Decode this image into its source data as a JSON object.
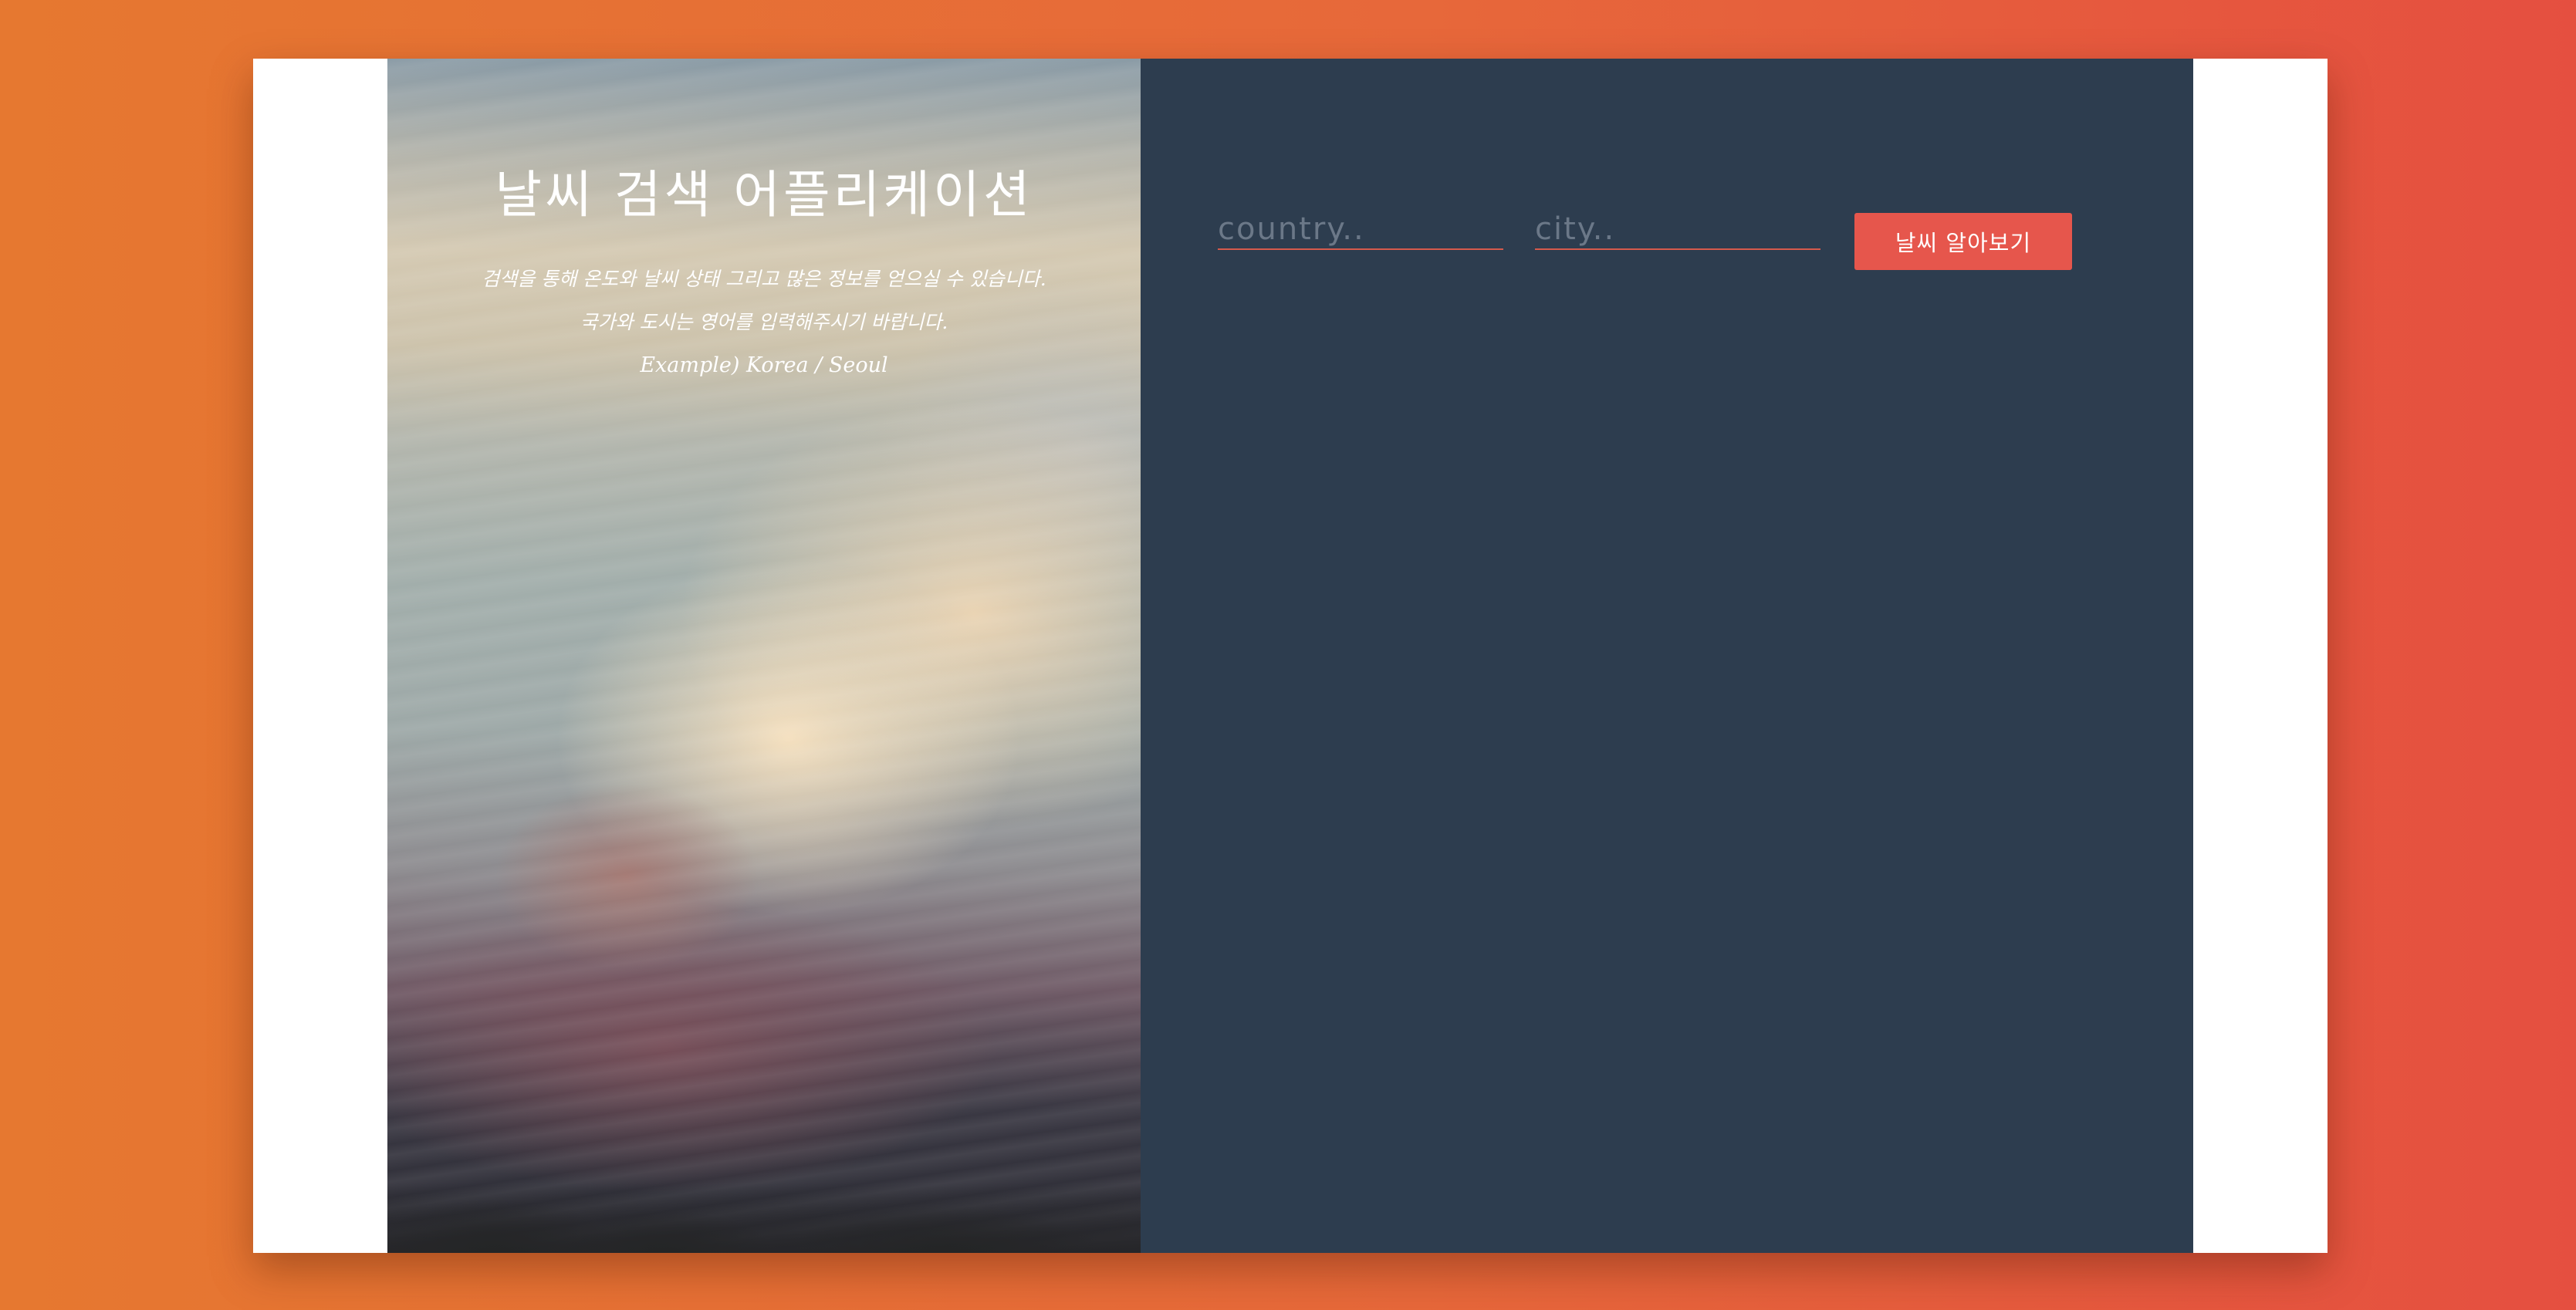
{
  "hero": {
    "title": "날씨 검색 어플리케이션",
    "description_line_1": "검색을 통해 온도와 날씨 상태 그리고 많은 정보를 얻으실 수 있습니다.",
    "description_line_2": "국가와 도시는 영어를 입력해주시기 바랍니다.",
    "example": "Example) Korea / Seoul",
    "background_image": "sunset-clouds-sky"
  },
  "search_form": {
    "country_placeholder": "country..",
    "city_placeholder": "city..",
    "submit_label": "날씨 알아보기"
  },
  "colors": {
    "background_gradient_start": "#e67830",
    "background_gradient_end": "#e54f40",
    "panel": "#2d3d4f",
    "accent": "#e6564c",
    "card": "#ffffff"
  }
}
